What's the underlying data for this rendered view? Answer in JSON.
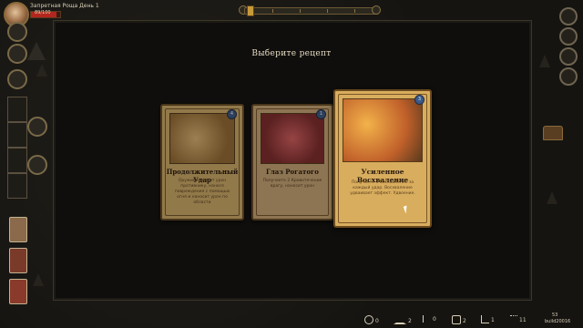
{
  "hud": {
    "location": "Запретная Роща День 1",
    "hp": "89/100",
    "hp_fraction": 0.89
  },
  "modal": {
    "title": "Выберите рецепт"
  },
  "cards": [
    {
      "name": "Продолжительный Удар",
      "description": "Оружие наносит урон противнику, нанося повреждения с помощью огня и наносит урон по области",
      "cost": "4",
      "art_color": "#c98a3a",
      "selected": false
    },
    {
      "name": "Глаз Рогатого",
      "description": "Получаете 2 Кровотечение врагу, наносит урон",
      "cost": "1",
      "art_color": "#b03a3a",
      "selected": false
    },
    {
      "name": "Усиленное Восхваление",
      "description": "Получаете 3 Восхваление за каждый удар. Восхваление удваивает эффект. Удвоение.",
      "cost": "3",
      "art_color": "#d6822a",
      "selected": true
    }
  ],
  "resources": [
    {
      "icon": "key-icon",
      "value": "0"
    },
    {
      "icon": "chalice-icon",
      "value": "2"
    },
    {
      "icon": "herb-icon",
      "value": "0"
    },
    {
      "icon": "hand-icon",
      "value": "2"
    },
    {
      "icon": "bar-chart-icon",
      "value": "1"
    },
    {
      "icon": "dots-icon",
      "value": "11"
    }
  ],
  "coins": "53",
  "build": "build20016"
}
